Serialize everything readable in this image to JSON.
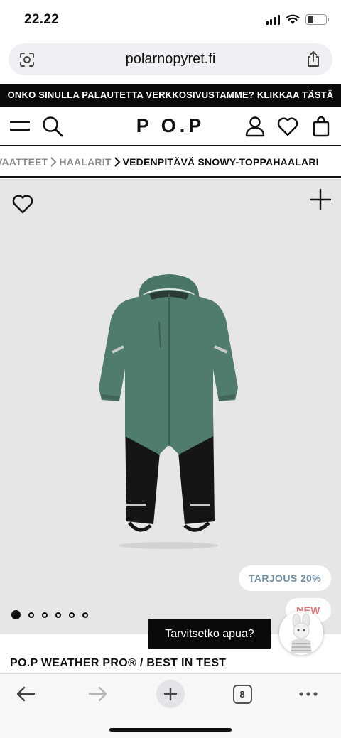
{
  "status_bar": {
    "time": "22.22",
    "battery_level": "34"
  },
  "address_bar": {
    "url": "polarnopyret.fi"
  },
  "promo_banner": {
    "text": "ONKO SINULLA PALAUTETTA VERKKOSIVUSTAMME? KLIKKAA TÄSTÄ"
  },
  "header": {
    "logo": "P O.P"
  },
  "breadcrumb": {
    "items": [
      "VAATTEET",
      "HAALARIT"
    ],
    "current": "VEDENPITÄVÄ SNOWY-TOPPAHAALARI"
  },
  "product": {
    "offer_badge": "TARJOUS 20%",
    "new_badge": "NEW",
    "image_count": 6,
    "active_image": 1,
    "title": "PO.P WEATHER PRO® / BEST IN TEST",
    "colors": {
      "upper": "#4f7c6b",
      "lower": "#151515",
      "background": "#e6e6e6"
    }
  },
  "help": {
    "label": "Tarvitsetko apua?"
  },
  "browser_toolbar": {
    "tab_count": "8",
    "icons": [
      "back-arrow-icon",
      "forward-arrow-icon",
      "new-tab-plus-icon",
      "tabs-icon",
      "more-icon"
    ]
  }
}
